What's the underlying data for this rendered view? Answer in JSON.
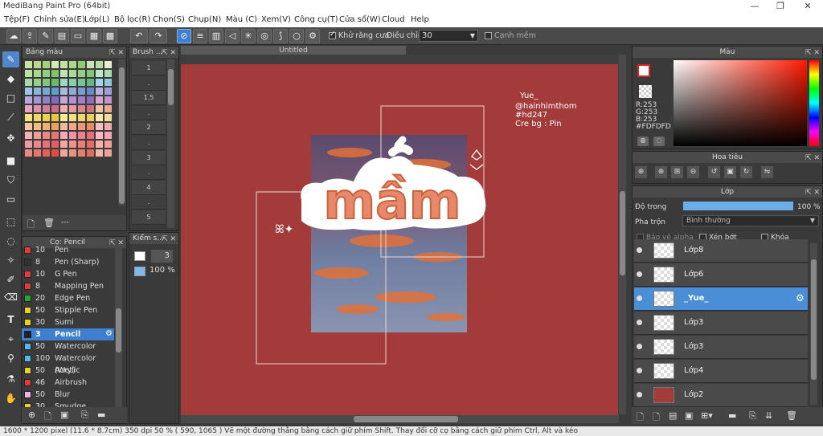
{
  "window": {
    "title": "MediBang Paint Pro (64bit)",
    "controls": [
      "—",
      "❐",
      "✕"
    ]
  },
  "menu": [
    "Tệp(F)",
    "Chỉnh sửa(E)",
    "Lớp(L)",
    "Bộ lọc(R)",
    "Chọn(S)",
    "Chụp(N)",
    "Màu (C)",
    "Xem(V)",
    "Công cụ(T)",
    "Cửa sổ(W)",
    "Cloud",
    "Help"
  ],
  "toolbar": {
    "antialias_label": "Khử răng cưa",
    "tolerance_label": "Điều chỉnh",
    "tolerance_value": "30",
    "edge_label": "Cạnh mềm"
  },
  "colors": {
    "accent": "#3f7fcf",
    "canvas_bg": "#a33b3b",
    "primary_color": "#fdfdfd"
  },
  "palette_panel": {
    "title": "Bảng màu",
    "footer": "---"
  },
  "brush_size_panel": {
    "title": "Brush ...",
    "sizes": [
      "1",
      ".",
      "1.5",
      ".",
      "2",
      ".",
      "3",
      ".",
      "4",
      ".",
      "5"
    ]
  },
  "brush_panel": {
    "title": "Cọ: Pencil",
    "items": [
      {
        "size": "10",
        "name": "Pen",
        "color": "#e23b3b"
      },
      {
        "size": "8",
        "name": "Pen (Sharp)",
        "color": "#333333"
      },
      {
        "size": "10",
        "name": "G Pen",
        "color": "#e23b3b"
      },
      {
        "size": "8",
        "name": "Mapping Pen",
        "color": "#e23b3b"
      },
      {
        "size": "20",
        "name": "Edge Pen",
        "color": "#2aa52a"
      },
      {
        "size": "50",
        "name": "Stipple Pen",
        "color": "#e8d21f"
      },
      {
        "size": "30",
        "name": "Sumi",
        "color": "#e8d21f"
      },
      {
        "size": "3",
        "name": "Pencil",
        "color": "#222222"
      },
      {
        "size": "50",
        "name": "Watercolor",
        "color": "#55b6f0"
      },
      {
        "size": "100",
        "name": "Watercolor (Wet)",
        "color": "#55b6f0"
      },
      {
        "size": "50",
        "name": "Acrylic",
        "color": "#e8d21f"
      },
      {
        "size": "46",
        "name": "Airbrush",
        "color": "#e23b3b"
      },
      {
        "size": "50",
        "name": "Blur",
        "color": "#f4b0e6"
      },
      {
        "size": "30",
        "name": "Smudge",
        "color": "#e8d21f"
      }
    ]
  },
  "brush_control_panel": {
    "title": "Kiểm s...",
    "size": "3",
    "opacity": "100 %"
  },
  "document": {
    "tab": "Untitled"
  },
  "artwork": {
    "word": "mầm",
    "credits": [
      "Yue_",
      "@hainhimthom",
      "#hd247",
      "Cre bg : Pin"
    ]
  },
  "color_panel": {
    "title": "Màu",
    "rgb": [
      "R:253",
      "G:253",
      "B:253"
    ],
    "hex": "#FDFDFD"
  },
  "navigator_panel": {
    "title": "Hoa tiêu"
  },
  "layer_panel": {
    "title": "Lớp",
    "opacity_label": "Độ trong",
    "opacity_value": "100 %",
    "opacity_level": 1.0,
    "blend_label": "Pha trộn",
    "blend_value": "Bình thường",
    "protect_alpha": "Bảo vệ alpha",
    "clipping": "Xén bớt",
    "lock": "Khóa",
    "layers": [
      {
        "name": "Lớp8",
        "selected": false
      },
      {
        "name": "Lớp6",
        "selected": false
      },
      {
        "name": "_Yue_",
        "selected": true
      },
      {
        "name": "Lớp3",
        "selected": false
      },
      {
        "name": "Lớp3",
        "selected": false
      },
      {
        "name": "Lớp4",
        "selected": false
      },
      {
        "name": "Lớp2",
        "selected": false
      }
    ]
  },
  "status": {
    "text": "1600 * 1200 pixel   (11.6 * 8.7cm)   350 dpi   50 %   ( 590, 1065 )   Vẽ một đường thẳng bằng cách giữ phím Shift. Thay đổi cỡ cọ bằng cách giữ phím Ctrl, Alt và kéo"
  }
}
